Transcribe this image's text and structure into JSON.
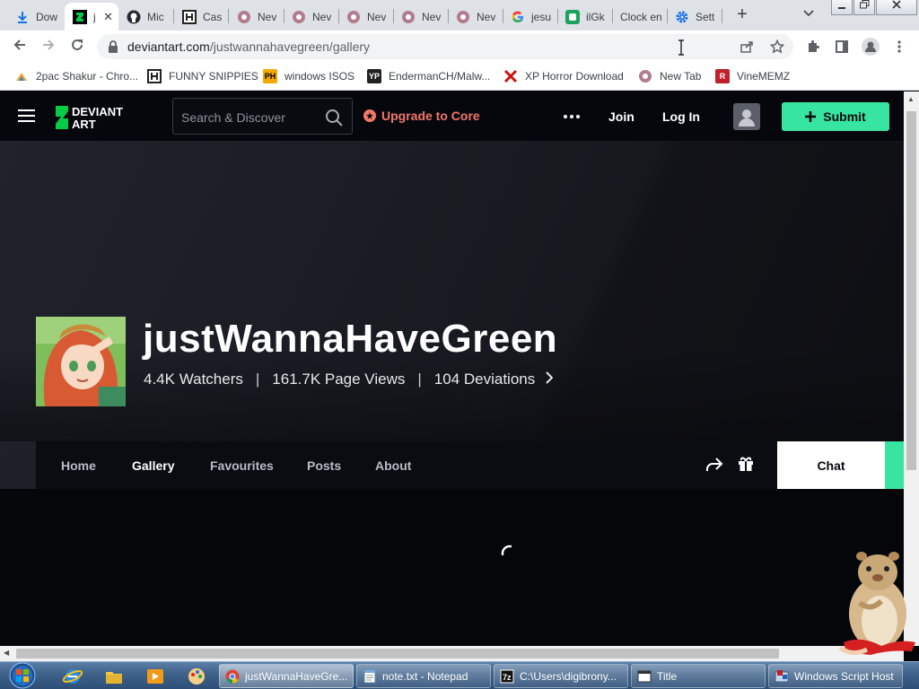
{
  "browser": {
    "tabs": [
      {
        "label": "Dow",
        "icon": "download-icon"
      },
      {
        "label": "j",
        "icon": "deviantart-icon"
      },
      {
        "label": "Mic",
        "icon": "github-icon"
      },
      {
        "label": "Cas",
        "icon": "letter-h-icon"
      },
      {
        "label": "Nev",
        "icon": "hamster-icon"
      },
      {
        "label": "Nev",
        "icon": "hamster-icon"
      },
      {
        "label": "Nev",
        "icon": "hamster-icon"
      },
      {
        "label": "Nev",
        "icon": "hamster-icon"
      },
      {
        "label": "Nev",
        "icon": "hamster-icon"
      },
      {
        "label": "jesu",
        "icon": "google-icon"
      },
      {
        "label": "ilGk",
        "icon": "green-app-icon"
      },
      {
        "label": "Clock en",
        "icon": ""
      },
      {
        "label": "Sett",
        "icon": "gear-icon"
      }
    ],
    "tab_close_glyph": "✕",
    "new_tab_glyph": "+",
    "address": {
      "host": "deviantart.com",
      "path": "/justwannahavegreen/gallery"
    },
    "bookmarks": [
      {
        "label": "2pac Shakur - Chro...",
        "icon": "bookmark-favicon-icon"
      },
      {
        "label": "FUNNY SNIPPIES",
        "icon": "letter-h-icon"
      },
      {
        "label": "windows ISOS",
        "icon": "ph-icon"
      },
      {
        "label": "EndermanCH/Malw...",
        "icon": "yp-icon"
      },
      {
        "label": "XP Horror Download",
        "icon": "red-x-icon"
      },
      {
        "label": "New Tab",
        "icon": "hamster-icon"
      },
      {
        "label": "VineMEMZ",
        "icon": "r-icon"
      }
    ]
  },
  "header": {
    "search_placeholder": "Search & Discover",
    "upgrade_label": "Upgrade to Core",
    "join_label": "Join",
    "login_label": "Log In",
    "submit_label": "Submit",
    "accent_color": "#38e5a0",
    "upgrade_color": "#f3776c"
  },
  "profile": {
    "username": "justWannaHaveGreen",
    "watchers": "4.4K Watchers",
    "page_views": "161.7K Page Views",
    "deviations": "104 Deviations",
    "separator": "|",
    "nav": {
      "home": "Home",
      "gallery": "Gallery",
      "favourites": "Favourites",
      "posts": "Posts",
      "about": "About",
      "chat": "Chat"
    }
  },
  "taskbar": {
    "tasks": [
      {
        "label": "justWannaHaveGre...",
        "icon": "chrome-icon"
      },
      {
        "label": "note.txt - Notepad",
        "icon": "notepad-icon"
      },
      {
        "label": "C:\\Users\\digibrony...",
        "icon": "7zip-icon"
      },
      {
        "label": "Title",
        "icon": "window-icon"
      },
      {
        "label": "Windows Script Host",
        "icon": "script-host-icon"
      }
    ]
  }
}
